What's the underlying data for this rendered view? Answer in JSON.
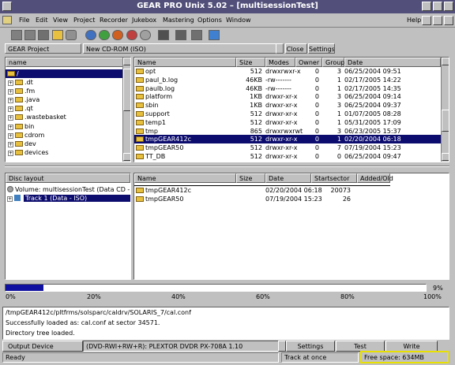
{
  "window": {
    "title": "GEAR PRO Unix 5.02 – [multisessionTest]"
  },
  "menus": [
    "File",
    "Edit",
    "View",
    "Project",
    "Recorder",
    "Jukebox",
    "Mastering",
    "Options",
    "Window"
  ],
  "help": "Help",
  "gear_project": {
    "label": "GEAR Project",
    "type": "New CD-ROM (ISO)",
    "close": "Close",
    "settings": "Settings"
  },
  "tree": {
    "header": "name",
    "root": "/",
    "items": [
      ".dt",
      ".fm",
      ".java",
      ".qt",
      ".wastebasket",
      "bin",
      "cdrom",
      "dev",
      "devices"
    ]
  },
  "files": {
    "columns": [
      "Name",
      "Size",
      "Modes",
      "Owner",
      "Group",
      "Date"
    ],
    "rows": [
      [
        "opt",
        "512",
        "drwxrwxr-x",
        "0",
        "3",
        "06/25/2004 09:51"
      ],
      [
        "paul_b.log",
        "46KB",
        "-rw-------",
        "0",
        "1",
        "02/17/2005 14:22"
      ],
      [
        "paulb.log",
        "46KB",
        "-rw-------",
        "0",
        "1",
        "02/17/2005 14:35"
      ],
      [
        "platform",
        "1KB",
        "drwxr-xr-x",
        "0",
        "3",
        "06/25/2004 09:14"
      ],
      [
        "sbin",
        "1KB",
        "drwxr-xr-x",
        "0",
        "3",
        "06/25/2004 09:37"
      ],
      [
        "support",
        "512",
        "drwxr-xr-x",
        "0",
        "1",
        "01/07/2005 08:28"
      ],
      [
        "temp1",
        "512",
        "drwxr-xr-x",
        "0",
        "1",
        "05/31/2005 17:09"
      ],
      [
        "tmp",
        "865",
        "drwxrwxrwt",
        "0",
        "3",
        "06/23/2005 15:37"
      ],
      [
        "tmpGEAR412c",
        "512",
        "drwxr-xr-x",
        "0",
        "1",
        "02/20/2004 06:18"
      ],
      [
        "tmpGEAR50",
        "512",
        "drwxr-xr-x",
        "0",
        "7",
        "07/19/2004 15:23"
      ],
      [
        "TT_DB",
        "512",
        "drwxr-xr-x",
        "0",
        "0",
        "06/25/2004 09:47"
      ]
    ],
    "selected": 8
  },
  "disc": {
    "header": "Disc layout",
    "volume": "Volume: multisessionTest (Data CD - ISO)",
    "track": "Track 1 (Data - ISO)"
  },
  "disc_files": {
    "columns": [
      "Name",
      "Size",
      "Date",
      "Startsector",
      "Added/Old"
    ],
    "rows": [
      [
        "tmpGEAR412c",
        "",
        "02/20/2004 06:18",
        "20073",
        ""
      ],
      [
        "tmpGEAR50",
        "",
        "07/19/2004 15:23",
        "26",
        ""
      ]
    ]
  },
  "progress": {
    "fill": 0.09,
    "percent_label": "9%",
    "ticks": [
      "0%",
      "20%",
      "40%",
      "60%",
      "80%",
      "100%"
    ]
  },
  "log": [
    "/tmpGEAR412c/pltfrms/solsparc/caldrv/SOLARIS_7/cal.conf",
    "Successfully loaded as: cal.conf at sector 34571.",
    "Directory tree loaded."
  ],
  "device": {
    "label": "Output Device",
    "value": "(DVD-RWI+RW+R): PLEXTOR DVDR   PX-708A 1.10",
    "settings": "Settings",
    "test": "Test",
    "write": "Write"
  },
  "status": {
    "left": "Ready",
    "mode": "Track at once",
    "free": "Free space: 634MB"
  }
}
